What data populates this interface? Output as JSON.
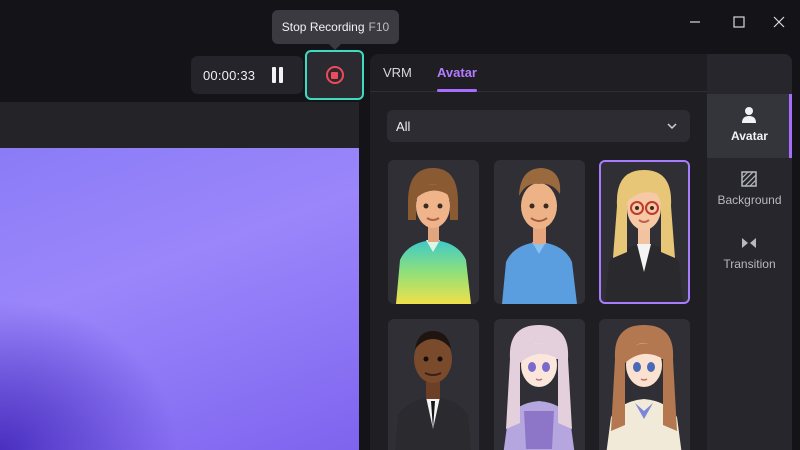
{
  "tooltip": {
    "label": "Stop Recording",
    "shortcut": "F10"
  },
  "recording": {
    "elapsed": "00:00:33"
  },
  "tabs": [
    {
      "label": "VRM"
    },
    {
      "label": "Avatar"
    }
  ],
  "filter": {
    "selected": "All"
  },
  "rail": [
    {
      "label": "Avatar",
      "icon": "avatar-icon"
    },
    {
      "label": "Background",
      "icon": "background-icon"
    },
    {
      "label": "Transition",
      "icon": "transition-icon"
    }
  ],
  "colors": {
    "accent": "#a86cff",
    "stop": "#ef4a5a",
    "focus": "#3ddbc0"
  }
}
